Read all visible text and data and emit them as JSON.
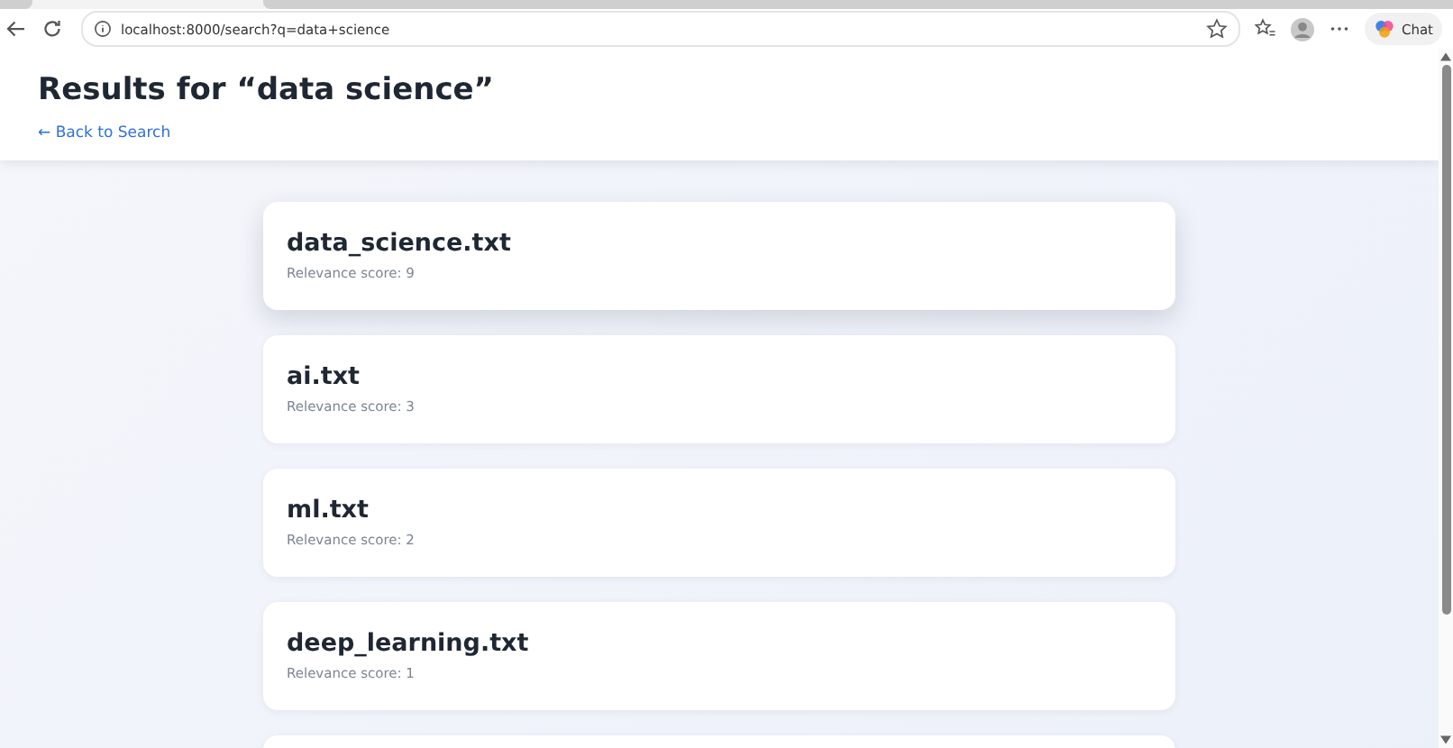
{
  "browser": {
    "url": "localhost:8000/search?q=data+science",
    "chat_label": "Chat"
  },
  "header": {
    "title": "Results for “data science”",
    "back_link": "← Back to Search"
  },
  "results": [
    {
      "filename": "data_science.txt",
      "score": "Relevance score: 9",
      "hovered": true
    },
    {
      "filename": "ai.txt",
      "score": "Relevance score: 3",
      "hovered": false
    },
    {
      "filename": "ml.txt",
      "score": "Relevance score: 2",
      "hovered": false
    },
    {
      "filename": "deep_learning.txt",
      "score": "Relevance score: 1",
      "hovered": false
    }
  ]
}
